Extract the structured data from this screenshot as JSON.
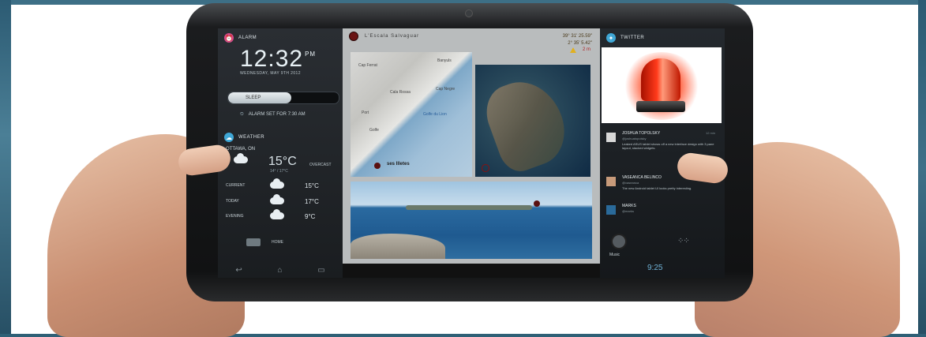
{
  "alarm": {
    "header": "ALARM",
    "time": "12:32",
    "ampm": "PM",
    "date": "WEDNESDAY, MAY 9TH 2012",
    "sleep_label": "SLEEP",
    "alarm_set": "ALARM SET FOR 7:30 AM"
  },
  "weather": {
    "header": "WEATHER",
    "city": "OTTAWA, ON",
    "current_temp": "15°C",
    "range": "14° / 17°C",
    "condition": "OVERCAST",
    "forecast": [
      {
        "name": "CURRENT",
        "temp": "15°C"
      },
      {
        "name": "TODAY",
        "temp": "17°C"
      },
      {
        "name": "EVENING",
        "temp": "9°C"
      }
    ]
  },
  "home_label": "HOME",
  "map": {
    "title": "L'Escala Salvaguar",
    "coords_line1": "39° 31' 25.59\"",
    "coords_line2": "2° 35' 5.42\"",
    "distance": "2 m",
    "bay_label": "Golfe du Lion",
    "marker_label": "ses Illetes",
    "place_labels": [
      "Cap Ferrat",
      "Banyuls",
      "Cala Rossa",
      "Cap Negre",
      "Port",
      "Golfe"
    ]
  },
  "twitter": {
    "header": "TWITTER",
    "tweets": [
      {
        "name": "JOSHUA TOPOLSKY",
        "handle": "@joshuatopolsky",
        "time": "12 min",
        "text": "Leaked ASUS tablet shows off a new interface design with 3 pane layout, stacked widgets."
      },
      {
        "name": "VASEANCA BELINCO",
        "handle": "@vaseanca",
        "time": "",
        "text": "The new Android tablet UI looks pretty interesting."
      },
      {
        "name": "MARKS",
        "handle": "@marks",
        "time": "",
        "text": ""
      }
    ]
  },
  "dock": {
    "music_label": "Music",
    "status_time": "9:25"
  },
  "colors": {
    "alarm_icon": "#d64a8a",
    "weather_icon": "#3fa7d6",
    "twitter_icon": "#3fa7d6",
    "marker": "#5a1010",
    "status": "#6fb2d6"
  }
}
